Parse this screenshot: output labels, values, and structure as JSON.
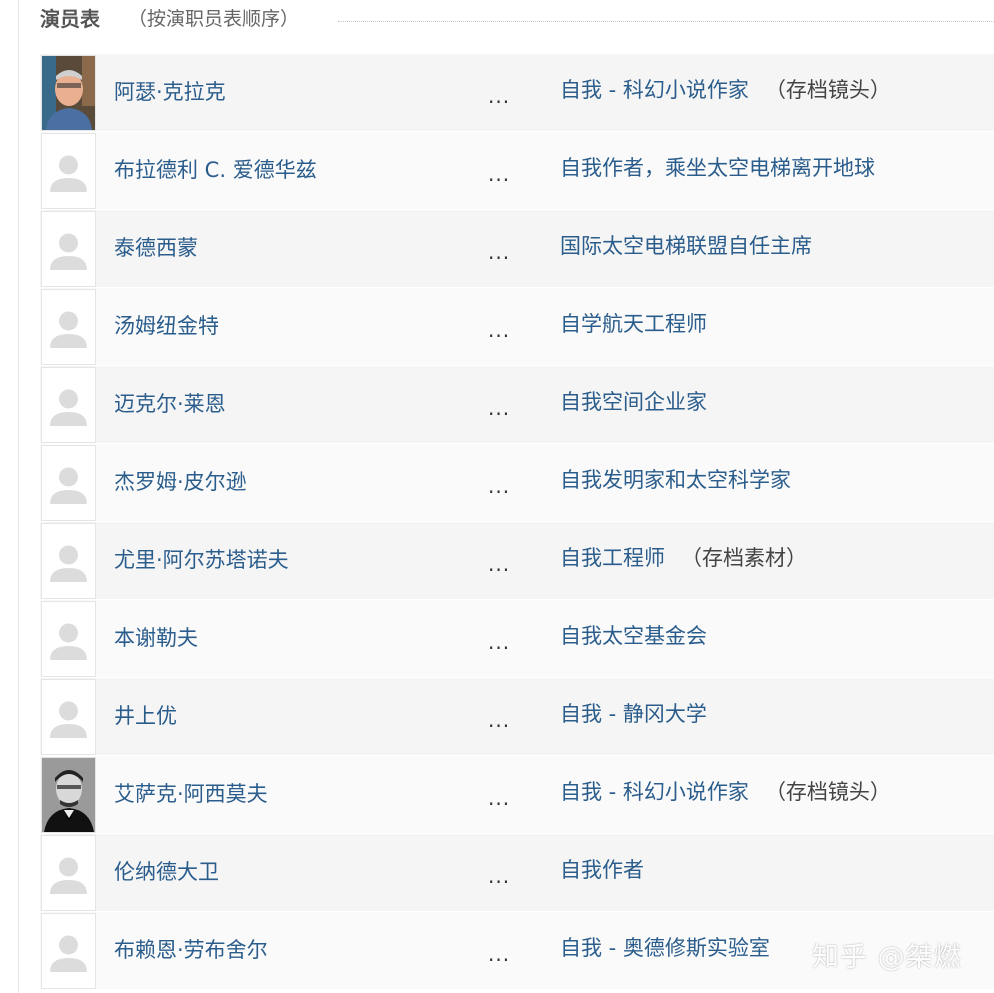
{
  "header": {
    "title": "演员表",
    "subtitle": "（按演职员表顺序）"
  },
  "cast": [
    {
      "name": "阿瑟·克拉克",
      "character": "自我 - 科幻小说作家",
      "note": "（存档镜头）",
      "photo": "portrait-photo"
    },
    {
      "name": "布拉德利 C. 爱德华兹",
      "character": "自我作者，乘坐太空电梯离开地球",
      "note": "",
      "photo": "no-photo-placeholder"
    },
    {
      "name": "泰德西蒙",
      "character": "国际太空电梯联盟自任主席",
      "note": "",
      "photo": "no-photo-placeholder"
    },
    {
      "name": "汤姆纽金特",
      "character": "自学航天工程师",
      "note": "",
      "photo": "no-photo-placeholder"
    },
    {
      "name": "迈克尔·莱恩",
      "character": "自我空间企业家",
      "note": "",
      "photo": "no-photo-placeholder"
    },
    {
      "name": "杰罗姆·皮尔逊",
      "character": "自我发明家和太空科学家",
      "note": "",
      "photo": "no-photo-placeholder"
    },
    {
      "name": "尤里·阿尔苏塔诺夫",
      "character": "自我工程师",
      "note": "（存档素材）",
      "photo": "no-photo-placeholder"
    },
    {
      "name": "本谢勒夫",
      "character": "自我太空基金会",
      "note": "",
      "photo": "no-photo-placeholder"
    },
    {
      "name": "井上优",
      "character": "自我 - 静冈大学",
      "note": "",
      "photo": "no-photo-placeholder"
    },
    {
      "name": "艾萨克·阿西莫夫",
      "character": "自我 - 科幻小说作家",
      "note": "（存档镜头）",
      "photo": "portrait-photo-bw"
    },
    {
      "name": "伦纳德大卫",
      "character": "自我作者",
      "note": "",
      "photo": "no-photo-placeholder"
    },
    {
      "name": "布赖恩·劳布舍尔",
      "character": "自我 - 奥德修斯实验室",
      "note": "",
      "photo": "no-photo-placeholder"
    }
  ],
  "ellipsis": "...",
  "watermark": "知乎 @桀燃",
  "colors": {
    "link": "#2b5d8c",
    "row_alt": "#f5f5f5"
  }
}
